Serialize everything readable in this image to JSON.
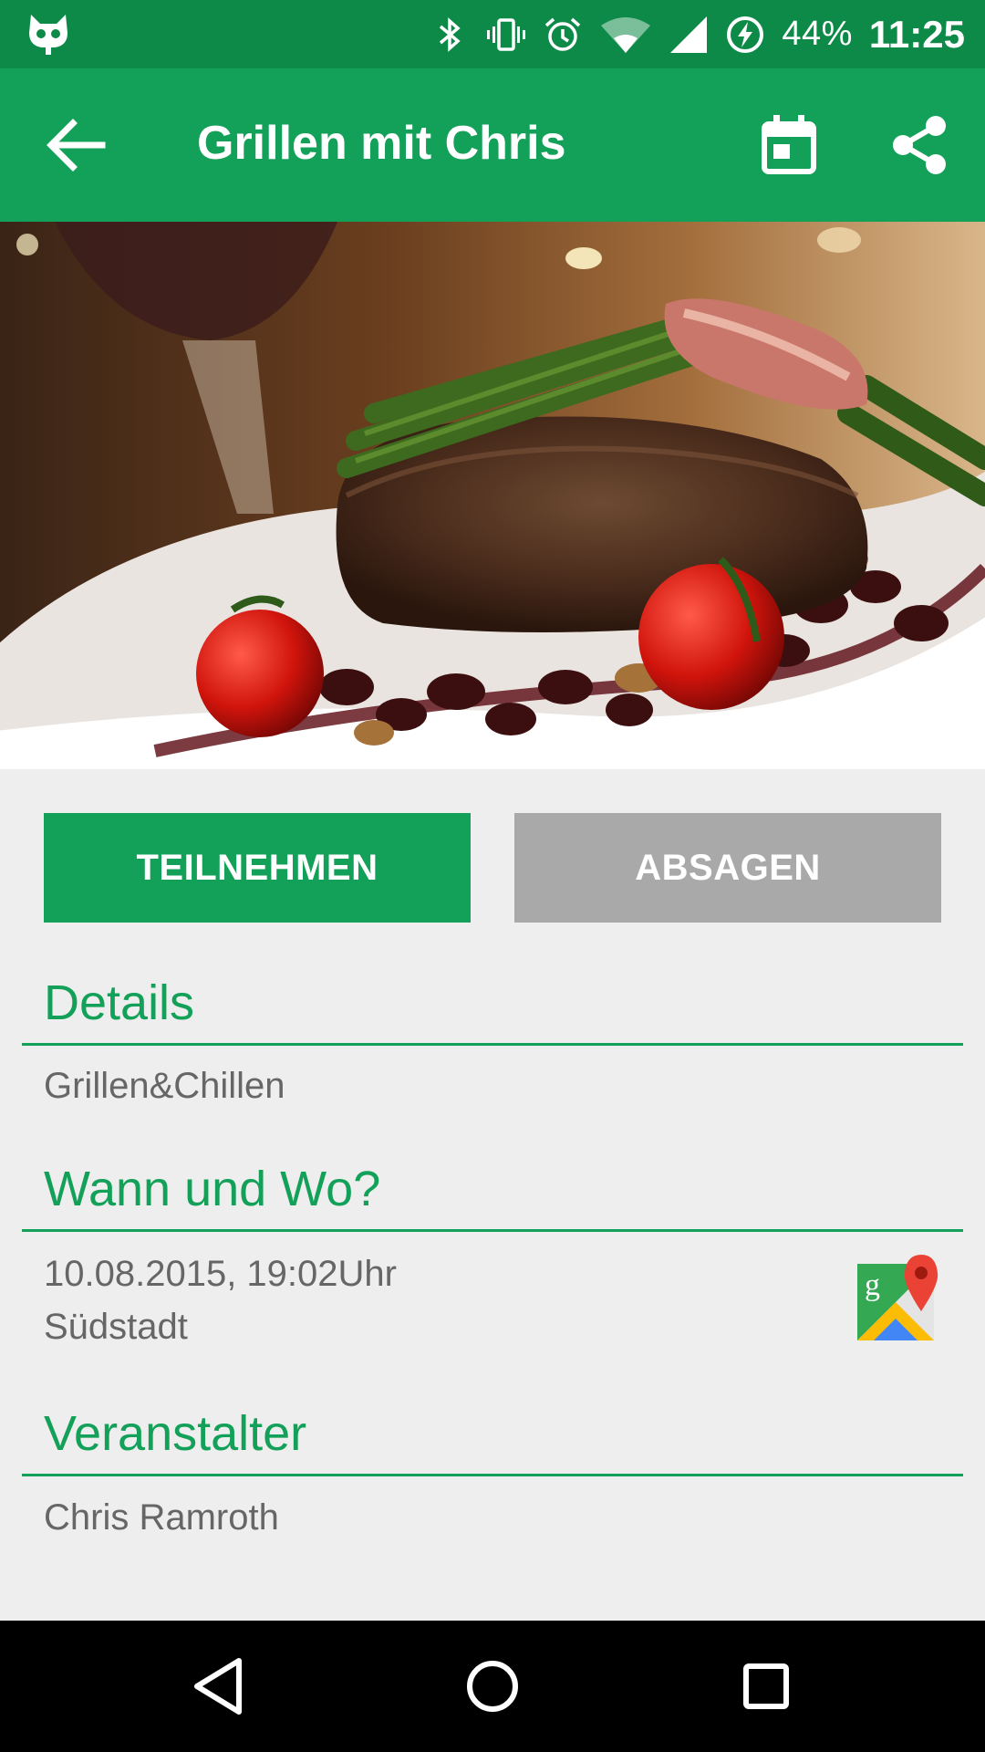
{
  "status_bar": {
    "battery": "44%",
    "time": "11:25",
    "icons": [
      "cyanogen-cat-icon",
      "bluetooth-icon",
      "vibrate-icon",
      "alarm-icon",
      "wifi-icon",
      "signal-icon",
      "battery-charging-icon"
    ]
  },
  "toolbar": {
    "title": "Grillen mit Chris",
    "icons": [
      "arrow-back-icon",
      "calendar-icon",
      "share-icon"
    ]
  },
  "hero": {
    "alt": "steak-with-asparagus-photo"
  },
  "actions": {
    "join_label": "TEILNEHMEN",
    "cancel_label": "ABSAGEN"
  },
  "sections": {
    "details": {
      "title": "Details",
      "text": "Grillen&Chillen"
    },
    "when_where": {
      "title": "Wann und Wo?",
      "datetime": "10.08.2015, 19:02Uhr",
      "location": "Südstadt"
    },
    "organizer": {
      "title": "Veranstalter",
      "name": "Chris Ramroth"
    }
  },
  "nav_bar": {
    "icons": [
      "back-triangle-icon",
      "home-circle-icon",
      "recents-square-icon"
    ]
  },
  "colors": {
    "status_bar": "#0e8a48",
    "toolbar": "#13a058",
    "accent": "#13a058",
    "cancel_button": "#a9a9a9",
    "background": "#eeeeee",
    "text_secondary": "#666666"
  }
}
